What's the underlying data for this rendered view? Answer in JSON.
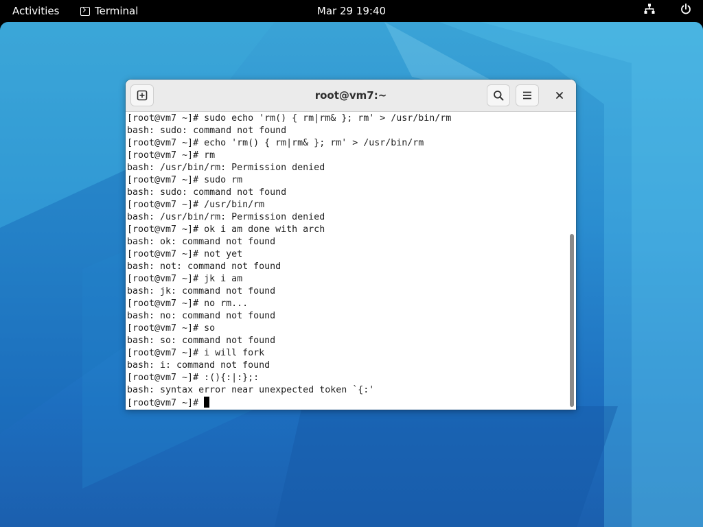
{
  "topbar": {
    "activities_label": "Activities",
    "app_name": "Terminal",
    "app_icon": "terminal-icon",
    "clock": "Mar 29  19:40",
    "status_icons": [
      "network-icon",
      "power-icon"
    ]
  },
  "window": {
    "title": "root@vm7:~",
    "buttons": [
      "new-tab-icon",
      "search-icon",
      "hamburger-menu-icon",
      "close-icon"
    ]
  },
  "terminal": {
    "lines": [
      "[root@vm7 ~]# sudo echo 'rm() { rm|rm& }; rm' > /usr/bin/rm",
      "bash: sudo: command not found",
      "[root@vm7 ~]# echo 'rm() { rm|rm& }; rm' > /usr/bin/rm",
      "[root@vm7 ~]# rm",
      "bash: /usr/bin/rm: Permission denied",
      "[root@vm7 ~]# sudo rm",
      "bash: sudo: command not found",
      "[root@vm7 ~]# /usr/bin/rm",
      "bash: /usr/bin/rm: Permission denied",
      "[root@vm7 ~]# ok i am done with arch",
      "bash: ok: command not found",
      "[root@vm7 ~]# not yet",
      "bash: not: command not found",
      "[root@vm7 ~]# jk i am",
      "bash: jk: command not found",
      "[root@vm7 ~]# no rm...",
      "bash: no: command not found",
      "[root@vm7 ~]# so",
      "bash: so: command not found",
      "[root@vm7 ~]# i will fork",
      "bash: i: command not found",
      "[root@vm7 ~]# :(){:|:};:",
      "bash: syntax error near unexpected token `{:'"
    ],
    "prompt": "[root@vm7 ~]# "
  },
  "colors": {
    "topbar_bg": "#000000",
    "desktop_accent": "#2a8dd0",
    "terminal_bg": "#ffffff",
    "terminal_fg": "#1e1e1e"
  }
}
